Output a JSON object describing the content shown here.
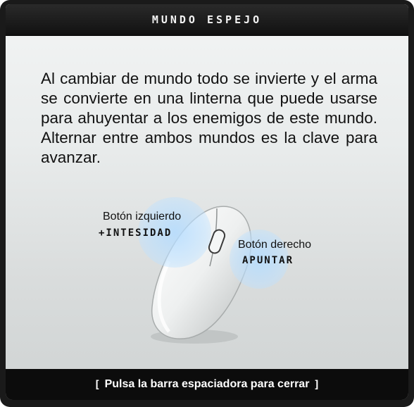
{
  "title": "MUNDO ESPEJO",
  "description": "Al cambiar de mundo todo se invierte y el arma se convierte en una linterna que puede usarse para ahuyentar a los enemigos de este mundo. Alternar entre ambos mundos es la clave para avanzar.",
  "mouse": {
    "left_label": "Botón izquierdo",
    "left_action": "+INTESIDAD",
    "right_label": "Botón derecho",
    "right_action": "APUNTAR"
  },
  "footer": {
    "bracket_left": "[",
    "text": "Pulsa la barra espaciadora para cerrar",
    "bracket_right": "]"
  },
  "colors": {
    "frame": "#1a1a1a",
    "panel_background": "#e9ecec",
    "highlight_bubble": "#b4dcff"
  }
}
